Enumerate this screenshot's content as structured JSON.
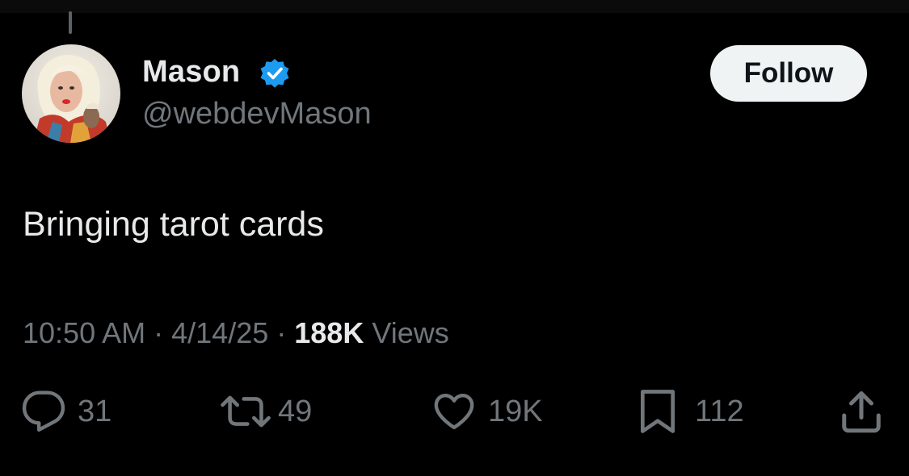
{
  "author": {
    "display_name": "Mason",
    "handle": "@webdevMason",
    "verified": true
  },
  "follow_label": "Follow",
  "tweet": {
    "text": "Bringing tarot cards",
    "time": "10:50 AM",
    "date": "4/14/25",
    "views_count": "188K",
    "views_label": "Views"
  },
  "actions": {
    "replies": "31",
    "reposts": "49",
    "likes": "19K",
    "bookmarks": "112"
  },
  "colors": {
    "background": "#000000",
    "primary_text": "#e7e9ea",
    "secondary_text": "#71767b",
    "verified_blue": "#1d9bf0",
    "follow_button_bg": "#eff3f4"
  },
  "icons": [
    "reply-icon",
    "repost-icon",
    "like-icon",
    "bookmark-icon",
    "share-icon",
    "verified-badge-icon"
  ]
}
